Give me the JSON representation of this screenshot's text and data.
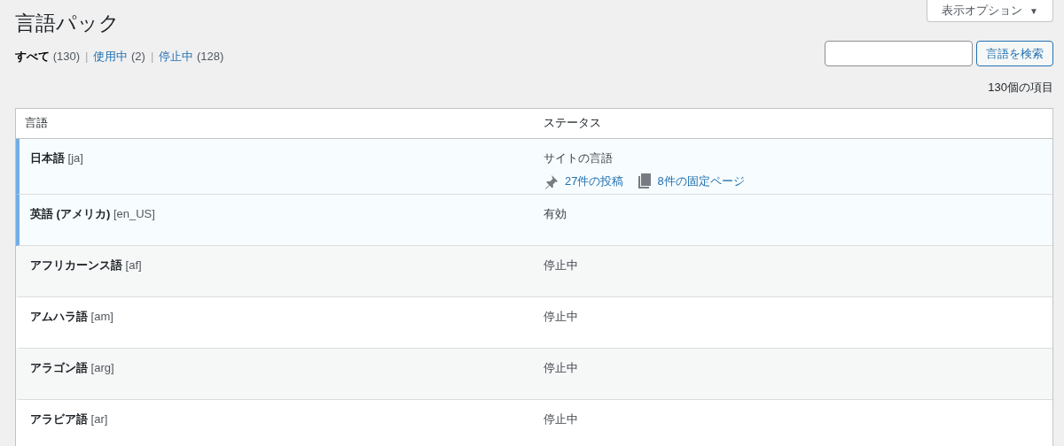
{
  "screen_options": {
    "label": "表示オプション",
    "caret": "▼"
  },
  "title": "言語パック",
  "filters": [
    {
      "label": "すべて",
      "count": "(130)",
      "selected": true
    },
    {
      "label": "使用中",
      "count": "(2)",
      "selected": false
    },
    {
      "label": "停止中",
      "count": "(128)",
      "selected": false
    }
  ],
  "separator": "|",
  "search": {
    "button": "言語を検索"
  },
  "item_count": "130個の項目",
  "table": {
    "columns": [
      "言語",
      "ステータス"
    ],
    "rows": [
      {
        "name": "**日本語** [ja]",
        "status": "サイトの言語",
        "active": true,
        "links": [
          {
            "kind": "pin",
            "label": "27件の投稿"
          },
          {
            "kind": "pages",
            "label": "8件の固定ページ"
          }
        ]
      },
      {
        "name": "**英語 (アメリカ)** [en_US]",
        "status": "有効",
        "active": true
      },
      {
        "name": "**アフリカーンス語** [af]",
        "status": "停止中",
        "active": false
      },
      {
        "name": "**アムハラ語** [am]",
        "status": "停止中",
        "active": false
      },
      {
        "name": "**アラゴン語** [arg]",
        "status": "停止中",
        "active": false
      },
      {
        "name": "**アラビア語** [ar]",
        "status": "停止中",
        "active": false
      }
    ]
  }
}
